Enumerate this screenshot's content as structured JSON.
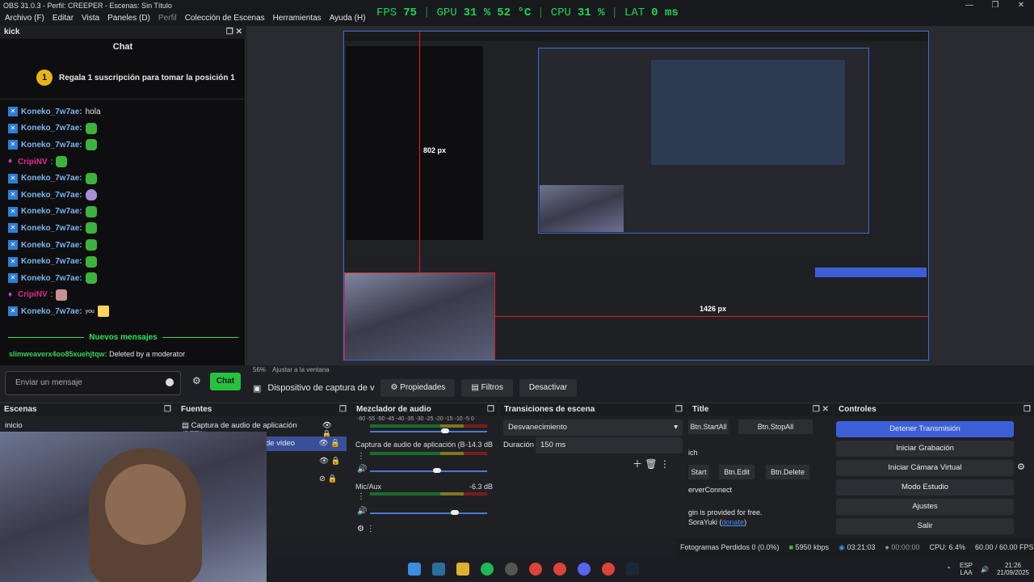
{
  "window": {
    "title": "OBS 31.0.3 - Perfil: CREEPER - Escenas: Sin Título",
    "controls": [
      "—",
      "❐",
      "✕"
    ]
  },
  "menu": [
    {
      "label": "Archivo (F)",
      "disabled": false
    },
    {
      "label": "Editar",
      "disabled": false
    },
    {
      "label": "Vista",
      "disabled": false
    },
    {
      "label": "Paneles (D)",
      "disabled": false
    },
    {
      "label": "Perfil",
      "disabled": true
    },
    {
      "label": "Colección de Escenas",
      "disabled": false
    },
    {
      "label": "Herramientas",
      "disabled": false
    },
    {
      "label": "Ayuda (H)",
      "disabled": false
    }
  ],
  "stats": {
    "fps_label": "FPS",
    "fps": "75",
    "gpu_label": "GPU",
    "gpu": "31 %",
    "gpu_temp": "52 °C",
    "cpu_label": "CPU",
    "cpu": "31 %",
    "lat_label": "LAT",
    "lat": "0 ms"
  },
  "chat": {
    "dock_title": "kick",
    "header": "Chat",
    "pinned_rank": "1",
    "pinned_text": "Regala 1 suscripción para tomar la posición 1",
    "messages": [
      {
        "user": "Koneko_7w7ae:",
        "text": "hola",
        "emote": "",
        "mod": false
      },
      {
        "user": "Koneko_7w7ae:",
        "text": "",
        "emote": "g",
        "mod": false
      },
      {
        "user": "Koneko_7w7ae:",
        "text": "",
        "emote": "g",
        "mod": false
      },
      {
        "user": "CripiNV",
        "text": ":",
        "emote": "g",
        "mod": true
      },
      {
        "user": "Koneko_7w7ae:",
        "text": "",
        "emote": "g",
        "mod": false
      },
      {
        "user": "Koneko_7w7ae:",
        "text": "",
        "emote": "d",
        "mod": false
      },
      {
        "user": "Koneko_7w7ae:",
        "text": "",
        "emote": "g",
        "mod": false
      },
      {
        "user": "Koneko_7w7ae:",
        "text": "",
        "emote": "g",
        "mod": false
      },
      {
        "user": "Koneko_7w7ae:",
        "text": "",
        "emote": "g",
        "mod": false
      },
      {
        "user": "Koneko_7w7ae:",
        "text": "",
        "emote": "g",
        "mod": false
      },
      {
        "user": "Koneko_7w7ae:",
        "text": "",
        "emote": "g",
        "mod": false
      },
      {
        "user": "CripiNV",
        "text": ":",
        "emote": "h",
        "mod": true
      },
      {
        "user": "Koneko_7w7ae:",
        "text": "you",
        "emote": "s",
        "mod": false
      }
    ],
    "new_messages": "Nuevos mensajes",
    "deleted_user": "slimweaverx4oo85xuehjtqw:",
    "deleted_text": "Deleted by a moderator",
    "input_placeholder": "Enviar un mensaje",
    "send_label": "Chat"
  },
  "preview": {
    "zoom": "56%",
    "fit_label": "Ajustar a la ventana",
    "px_h": "1426 px",
    "px_v": "802 px"
  },
  "source_toolbar": {
    "source_name": "Dispositivo de captura de v",
    "props": "Propiedades",
    "filters": "Filtros",
    "deactivate": "Desactivar"
  },
  "scenes": {
    "title": "Escenas",
    "items": [
      "inicio"
    ]
  },
  "sources": {
    "title": "Fuentes",
    "items": [
      "Captura de audio de aplicación (BETA)",
      "de video",
      "",
      ""
    ]
  },
  "mixer": {
    "title": "Mezclador de audio",
    "scale": "-60 -55 -50 -45 -40 -35 -30 -25 -20 -15 -10 -5 0",
    "channels": [
      {
        "name": "",
        "db": ""
      },
      {
        "name": "Captura de audio de aplicación (B",
        "db": "-14.3 dB"
      },
      {
        "name": "Mic/Aux",
        "db": "-6.3 dB"
      }
    ]
  },
  "transitions": {
    "title": "Transiciones de escena",
    "current": "Desvanecimiento",
    "duration_label": "Duración",
    "duration": "150 ms"
  },
  "titledock": {
    "title": "Title",
    "btn_startall": "Btn.StartAll",
    "btn_stopall": "Btn.StopAll",
    "line1": "ich",
    "btn_start": "Start",
    "btn_edit": "Btn.Edit",
    "btn_delete": "Btn.Delete",
    "line2": "erverConnect",
    "line3": "gin is provided for free.",
    "line4": "SoraYuki (",
    "donate": "donate",
    "line4end": ")"
  },
  "controls": {
    "title": "Controles",
    "stop_stream": "Detener Transmisión",
    "start_rec": "Iniciar Grabación",
    "virtual_cam": "Iniciar Cámara Virtual",
    "studio": "Modo Estudio",
    "settings": "Ajustes",
    "exit": "Salir"
  },
  "status": {
    "dropped": "Fotogramas Perdidos 0 (0.0%)",
    "bitrate": "5950 kbps",
    "stream_time": "03:21:03",
    "rec_time": "00:00:00",
    "cpu": "CPU: 6.4%",
    "fps": "60.00 / 60.00 FPS"
  },
  "tray": {
    "lang1": "ESP",
    "lang2": "LAA",
    "time": "21:26",
    "date": "21/09/2025"
  },
  "colors": {
    "accent": "#3c5fd8",
    "stats_green": "#1fd45a",
    "kick_green": "#26c23e"
  }
}
